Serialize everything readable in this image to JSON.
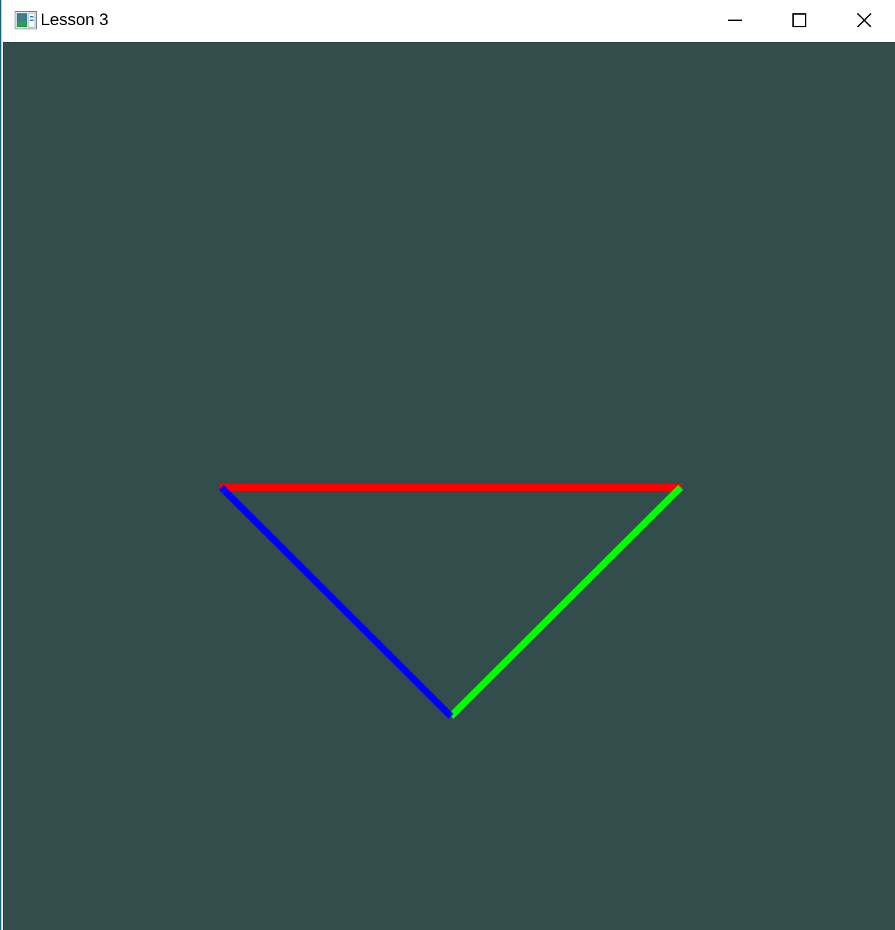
{
  "window": {
    "title": "Lesson 3",
    "app_icon": "opengl-window-icon",
    "controls": {
      "minimize_icon": "minimize-icon",
      "maximize_icon": "maximize-icon",
      "close_icon": "close-icon"
    }
  },
  "viewport": {
    "clear_color": "#334d4d"
  },
  "scene": {
    "primitive": "line-loop",
    "edges": [
      {
        "name": "top-edge",
        "color": "#ff0000"
      },
      {
        "name": "right-edge",
        "color": "#00ff00"
      },
      {
        "name": "left-edge",
        "color": "#0000ff"
      }
    ]
  }
}
